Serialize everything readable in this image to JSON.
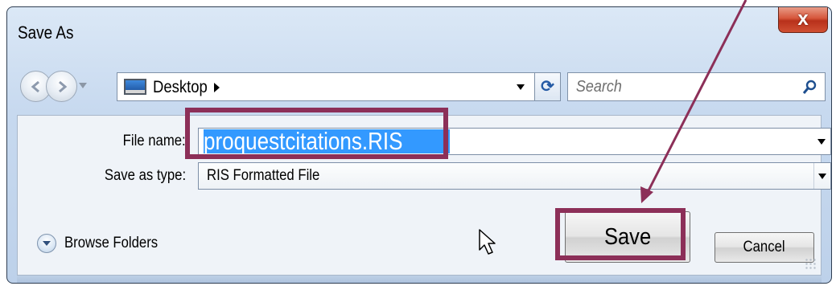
{
  "window": {
    "title": "Save As",
    "close_glyph": "x"
  },
  "nav": {
    "back_icon": "back-arrow-icon",
    "forward_icon": "forward-arrow-icon",
    "history_icon": "chevron-down-icon"
  },
  "address": {
    "location_icon": "desktop-icon",
    "location": "Desktop",
    "breadcrumb_icon": "chevron-right-icon",
    "dropdown_icon": "chevron-down-icon",
    "refresh_icon": "refresh-icon"
  },
  "search": {
    "placeholder": "Search",
    "icon": "search-icon"
  },
  "form": {
    "file_name_label": "File name:",
    "file_name_value": "proquestcitations.RIS",
    "save_type_label": "Save as type:",
    "save_type_value": "RIS Formatted File",
    "dropdown_icon": "chevron-down-icon"
  },
  "footer": {
    "browse_label": "Browse Folders",
    "browse_icon": "chevron-down-icon",
    "save_label": "Save",
    "cancel_label": "Cancel",
    "cursor_icon": "mouse-pointer-icon",
    "resize_icon": "resize-grip-icon"
  },
  "annotation": {
    "highlight_color": "#8c2f58",
    "selection_color": "#3399ff"
  }
}
